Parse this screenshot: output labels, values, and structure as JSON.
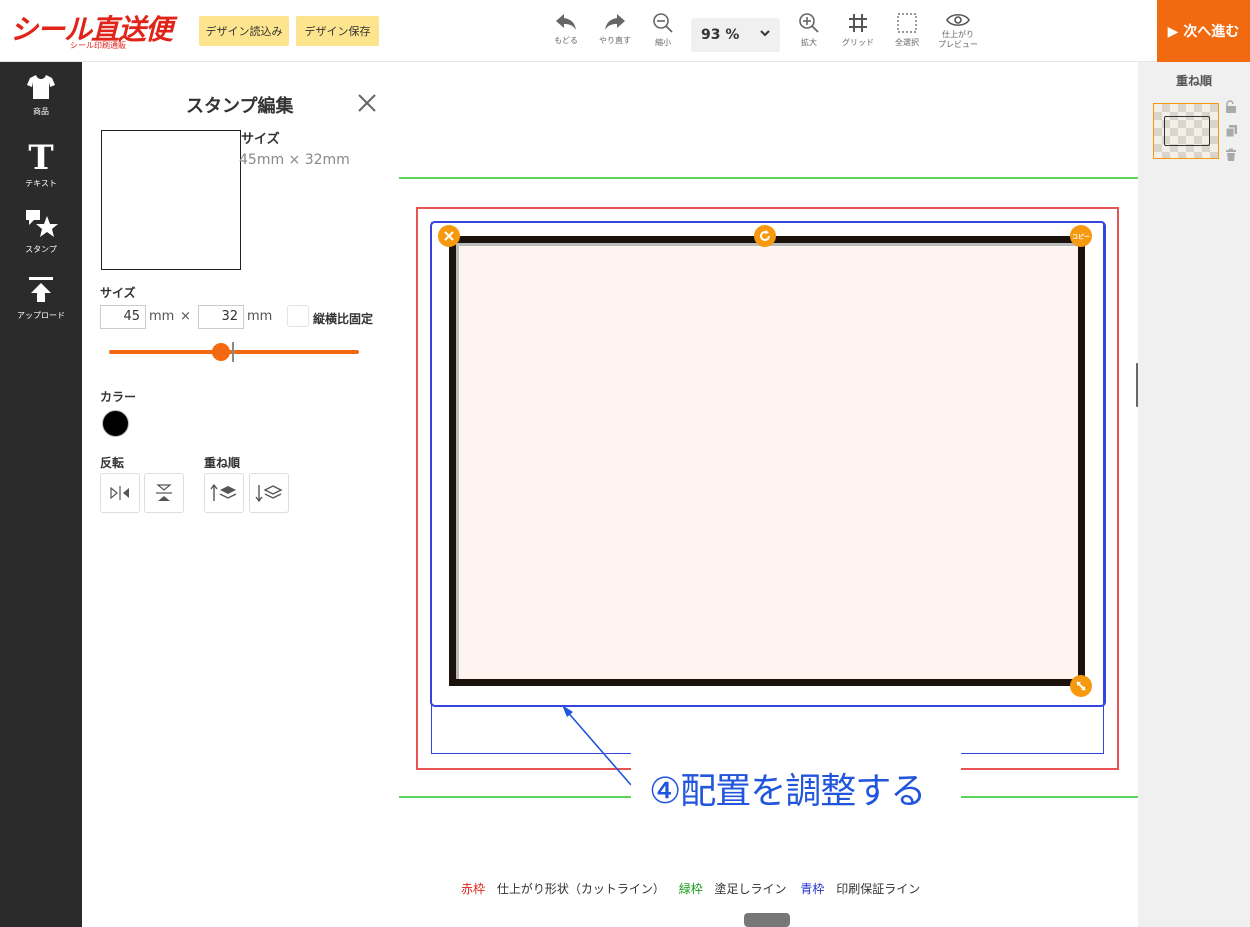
{
  "header": {
    "logo_main": "シール直送便",
    "logo_sub": "シール印刷通販",
    "load_design": "デザイン読込み",
    "save_design": "デザイン保存",
    "tools": {
      "undo": "もどる",
      "redo": "やり直す",
      "zoom_out": "縮小",
      "zoom_in": "拡大",
      "grid": "グリッド",
      "select_all": "全選択",
      "preview_line1": "仕上がり",
      "preview_line2": "プレビュー"
    },
    "zoom_value": "93 %",
    "next_button": "▶ 次へ進む"
  },
  "leftnav": {
    "items": [
      {
        "label": "商品",
        "icon": "tshirt-icon"
      },
      {
        "label": "テキスト",
        "icon": "text-icon"
      },
      {
        "label": "スタンプ",
        "icon": "stamp-icon"
      },
      {
        "label": "アップロード",
        "icon": "upload-icon"
      }
    ]
  },
  "panel": {
    "title": "スタンプ編集",
    "preview_size_heading": "サイズ",
    "preview_size_value": "45mm × 32mm",
    "size_label": "サイズ",
    "width_value": "45",
    "height_value": "32",
    "unit_mm": "mm",
    "times": "×",
    "lock_ratio_label": "縦横比固定",
    "color_label": "カラー",
    "color_value": "#000000",
    "flip_label": "反転",
    "order_label": "重ね順"
  },
  "canvas": {
    "handle_copy": "コピー",
    "annotation": "④配置を調整する",
    "legend": {
      "red_key": "赤枠",
      "red_desc": "仕上がり形状（カットライン）",
      "green_key": "緑枠",
      "green_desc": "塗足しライン",
      "blue_key": "青枠",
      "blue_desc": "印刷保証ライン"
    }
  },
  "rightpanel": {
    "title": "重ね順"
  },
  "colors": {
    "accent_orange": "#f26a10",
    "handle_orange": "#f7990e",
    "logo_red": "#e2231a",
    "selection_blue": "#3344e0",
    "cut_red": "#e85353",
    "bleed_green": "#5bd65b",
    "nav_dark": "#2b2b2b"
  }
}
